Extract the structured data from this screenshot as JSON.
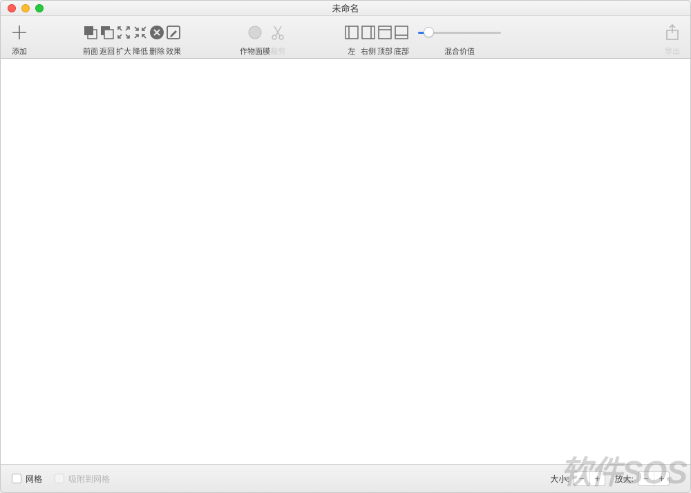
{
  "window": {
    "title": "未命名"
  },
  "toolbar": {
    "add": "添加",
    "front": "前面",
    "back": "返回",
    "enlarge": "扩大",
    "reduce": "降低",
    "delete": "删除",
    "effect": "效果",
    "cropmask": "作物面膜",
    "crop": "裁剪",
    "left": "左",
    "right": "右侧",
    "top": "顶部",
    "bottom": "底部",
    "blend": "混合价值",
    "export": "导出"
  },
  "status": {
    "grid": "网格",
    "snap": "吸附到网格",
    "size": "大小:",
    "zoom": "放大:"
  },
  "watermark": "软件SOS"
}
